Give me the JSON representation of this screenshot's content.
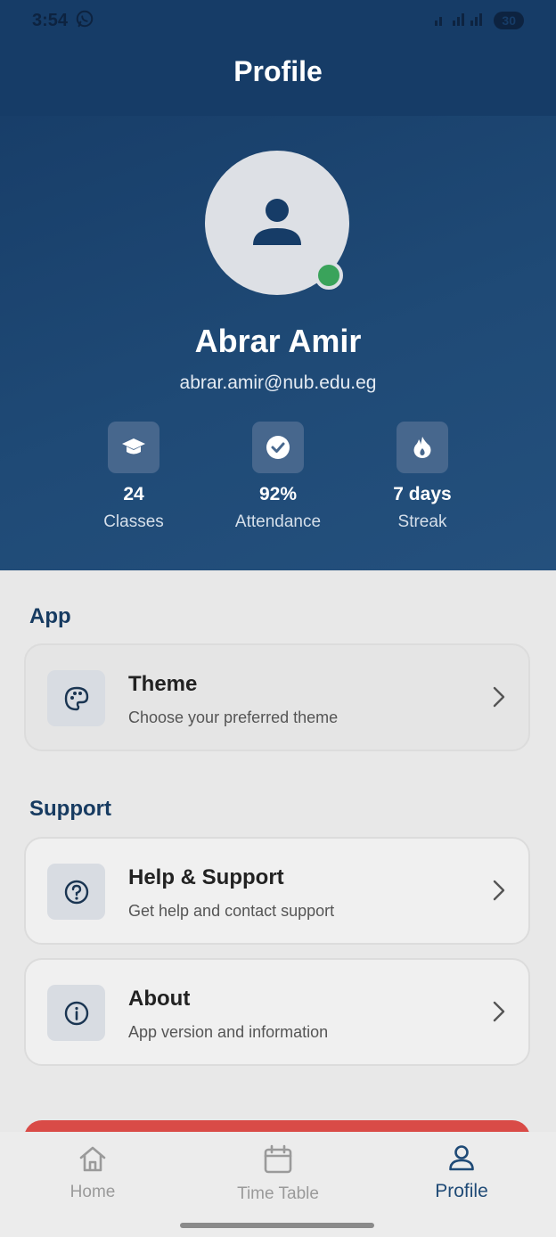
{
  "status_bar": {
    "time": "3:54",
    "battery": "30"
  },
  "header": {
    "title": "Profile"
  },
  "profile": {
    "name": "Abrar Amir",
    "email": "abrar.amir@nub.edu.eg"
  },
  "stats": [
    {
      "value": "24",
      "label": "Classes",
      "icon": "graduation-cap-icon"
    },
    {
      "value": "92%",
      "label": "Attendance",
      "icon": "check-circle-icon"
    },
    {
      "value": "7 days",
      "label": "Streak",
      "icon": "flame-icon"
    }
  ],
  "sections": {
    "app": {
      "title": "App",
      "items": [
        {
          "title": "Theme",
          "subtitle": "Choose your preferred theme",
          "icon": "palette-icon"
        }
      ]
    },
    "support": {
      "title": "Support",
      "items": [
        {
          "title": "Help & Support",
          "subtitle": "Get help and contact support",
          "icon": "help-circle-icon"
        },
        {
          "title": "About",
          "subtitle": "App version and information",
          "icon": "info-icon"
        }
      ]
    }
  },
  "bottom_nav": [
    {
      "label": "Home",
      "icon": "home-icon",
      "active": false
    },
    {
      "label": "Time Table",
      "icon": "calendar-icon",
      "active": false
    },
    {
      "label": "Profile",
      "icon": "user-icon",
      "active": true
    }
  ],
  "colors": {
    "header": "#163c67",
    "accent": "#1f4a76",
    "online": "#3aa35b",
    "logout": "#d94b47"
  }
}
